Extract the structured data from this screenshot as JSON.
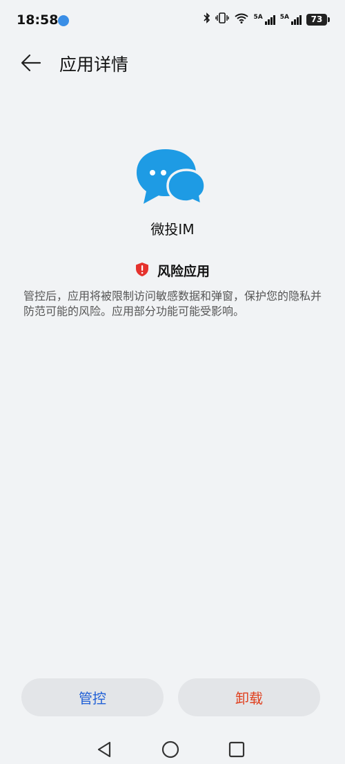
{
  "status_bar": {
    "time": "18:58",
    "signal1_label": "5A",
    "signal2_label": "5A",
    "battery": "73"
  },
  "header": {
    "title": "应用详情"
  },
  "app": {
    "name": "微投IM",
    "icon_color": "#1e9be4"
  },
  "risk": {
    "label": "风险应用",
    "description": "管控后，应用将被限制访问敏感数据和弹窗，保护您的隐私并防范可能的风险。应用部分功能可能受影响。",
    "shield_color": "#e5322d"
  },
  "actions": {
    "manage_label": "管控",
    "uninstall_label": "卸载",
    "manage_color": "#1f5fd6",
    "uninstall_color": "#e0401f"
  },
  "icons": [
    "app-notification-icon",
    "bluetooth-icon",
    "vibrate-icon",
    "wifi-icon",
    "signal-icon",
    "battery-icon",
    "back-arrow-icon",
    "chat-bubbles-icon",
    "shield-alert-icon",
    "nav-back-icon",
    "nav-home-icon",
    "nav-recents-icon"
  ]
}
